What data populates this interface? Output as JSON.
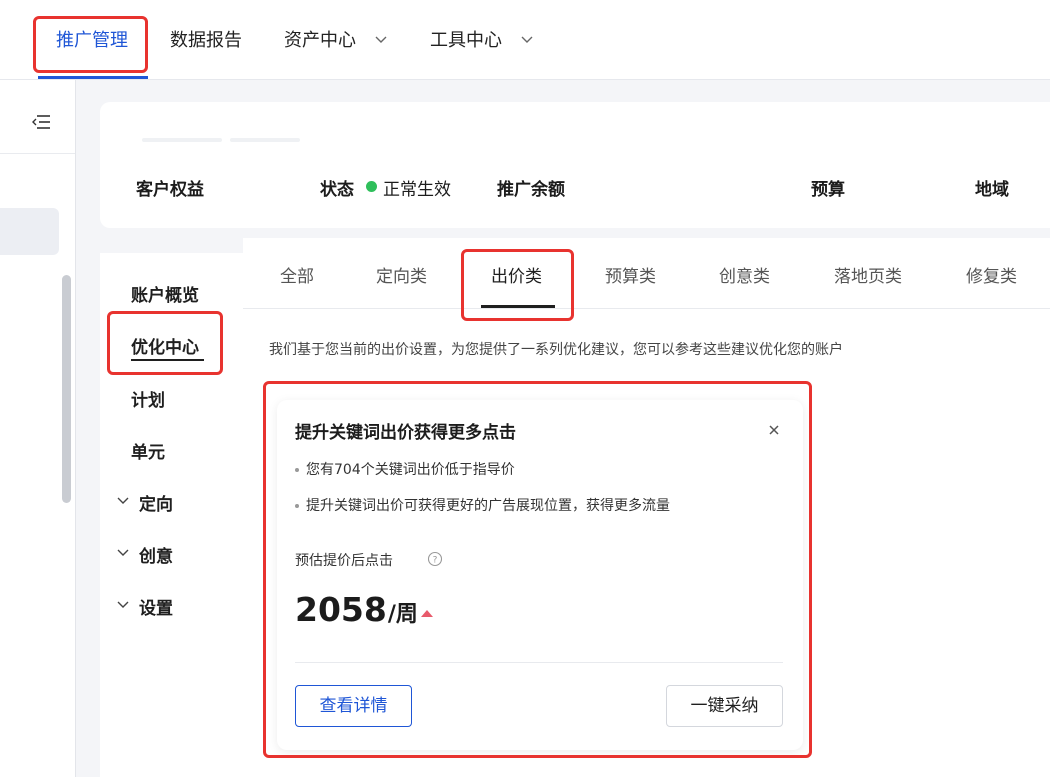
{
  "topnav": {
    "items": [
      {
        "label": "推广管理",
        "active": true
      },
      {
        "label": "数据报告",
        "active": false
      },
      {
        "label": "资产中心",
        "dropdown": true
      },
      {
        "label": "工具中心",
        "dropdown": true
      }
    ]
  },
  "account_info": {
    "customer_rights": "客户权益",
    "status_label": "状态",
    "status_value": "正常生效",
    "balance_label": "推广余额",
    "budget_label": "预算",
    "region_label": "地域"
  },
  "sidebar": {
    "items": [
      {
        "label": "账户概览"
      },
      {
        "label": "优化中心",
        "active": true
      },
      {
        "label": "计划"
      },
      {
        "label": "单元"
      },
      {
        "label": "定向",
        "expandable": true
      },
      {
        "label": "创意",
        "expandable": true
      },
      {
        "label": "设置",
        "expandable": true
      }
    ]
  },
  "tabs": {
    "items": [
      {
        "label": "全部"
      },
      {
        "label": "定向类"
      },
      {
        "label": "出价类",
        "active": true
      },
      {
        "label": "预算类"
      },
      {
        "label": "创意类"
      },
      {
        "label": "落地页类"
      },
      {
        "label": "修复类"
      }
    ]
  },
  "description": "我们基于您当前的出价设置，为您提供了一系列优化建议，您可以参考这些建议优化您的账户",
  "suggestion": {
    "title": "提升关键词出价获得更多点击",
    "bullets": [
      "您有704个关键词出价低于指导价",
      "提升关键词出价可获得更好的广告展现位置，获得更多流量"
    ],
    "estimate_label": "预估提价后点击",
    "estimate_value": "2058",
    "estimate_unit": "/周",
    "detail_button": "查看详情",
    "adopt_button": "一键采纳"
  },
  "colors": {
    "accent": "#1f56d6",
    "highlight_box": "#e8332f",
    "status_ok": "#2fbf5b",
    "trend_up": "#e85a6b"
  }
}
